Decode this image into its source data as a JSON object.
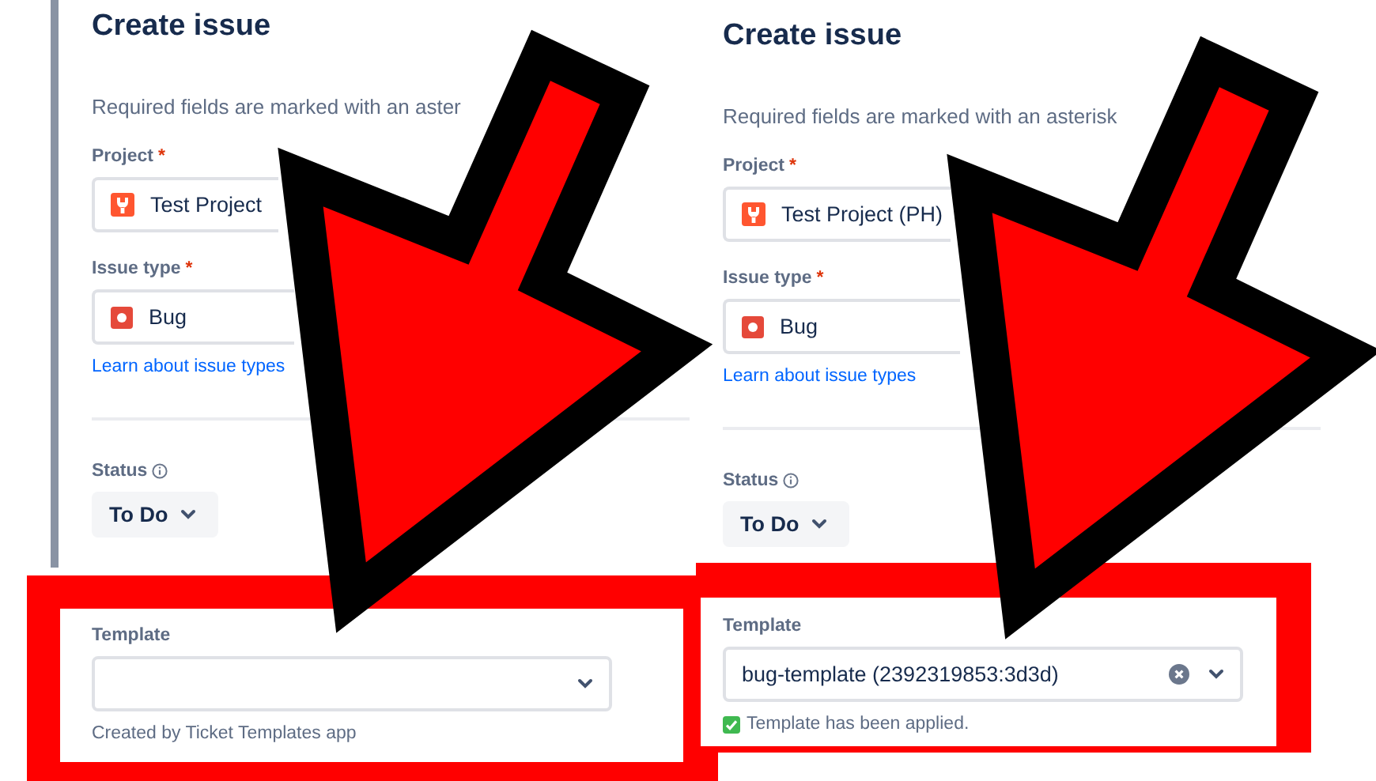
{
  "panels": [
    {
      "title": "Create issue",
      "required_note": "Required fields are marked with an aster",
      "project": {
        "label": "Project",
        "required_mark": "*",
        "value": "Test Project"
      },
      "issue_type": {
        "label": "Issue type",
        "required_mark": "*",
        "value": "Bug"
      },
      "learn_link": "Learn about issue types",
      "status": {
        "label": "Status",
        "value": "To Do"
      },
      "template": {
        "label": "Template",
        "clearable": false,
        "helper": "Created by Ticket Templates app",
        "applied": false
      }
    },
    {
      "title": "Create issue",
      "required_note": "Required fields are marked with an asterisk",
      "project": {
        "label": "Project",
        "required_mark": "*",
        "value": "Test Project (PH)"
      },
      "issue_type": {
        "label": "Issue type",
        "required_mark": "*",
        "value": "Bug"
      },
      "learn_link": "Learn about issue types",
      "status": {
        "label": "Status",
        "value": "To Do"
      },
      "template": {
        "label": "Template",
        "value": "bug-template (2392319853:3d3d)",
        "clearable": true,
        "helper": "Template has been applied.",
        "applied": true
      }
    }
  ]
}
